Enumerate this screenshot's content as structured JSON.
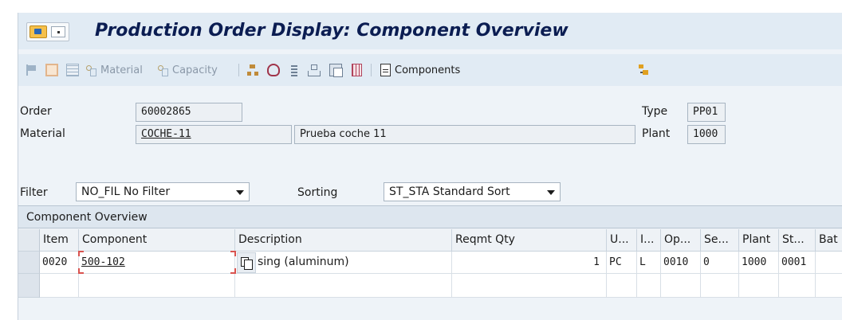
{
  "window": {
    "title": "Production Order Display: Component Overview"
  },
  "toolbar": {
    "material_label": "Material",
    "capacity_label": "Capacity",
    "components_label": "Components"
  },
  "header": {
    "order_label": "Order",
    "order_value": "60002865",
    "type_label": "Type",
    "type_value": "PP01",
    "material_label": "Material",
    "material_value": "COCHE-11",
    "material_desc": "Prueba coche 11",
    "plant_label": "Plant",
    "plant_value": "1000",
    "filter_label": "Filter",
    "filter_value": "NO_FIL No Filter",
    "sorting_label": "Sorting",
    "sorting_value": "ST_STA Standard Sort"
  },
  "panel": {
    "title": "Component Overview",
    "columns": [
      "Item",
      "Component",
      "Description",
      "Reqmt Qty",
      "U...",
      "I...",
      "Op...",
      "Se...",
      "Plant",
      "St...",
      "Bat"
    ],
    "rows": [
      {
        "item": "0020",
        "component": "500-102",
        "description": "sing (aluminum)",
        "reqmt_qty": "1",
        "unit": "PC",
        "item_cat": "L",
        "operation": "0010",
        "sequence": "0",
        "plant": "1000",
        "storage": "0001",
        "batch": ""
      }
    ]
  },
  "colors": {
    "title": "#0b1d52",
    "window_bg": "#eef3f8",
    "toolbar_bg": "#e1ebf4",
    "focus": "#d9534f"
  }
}
